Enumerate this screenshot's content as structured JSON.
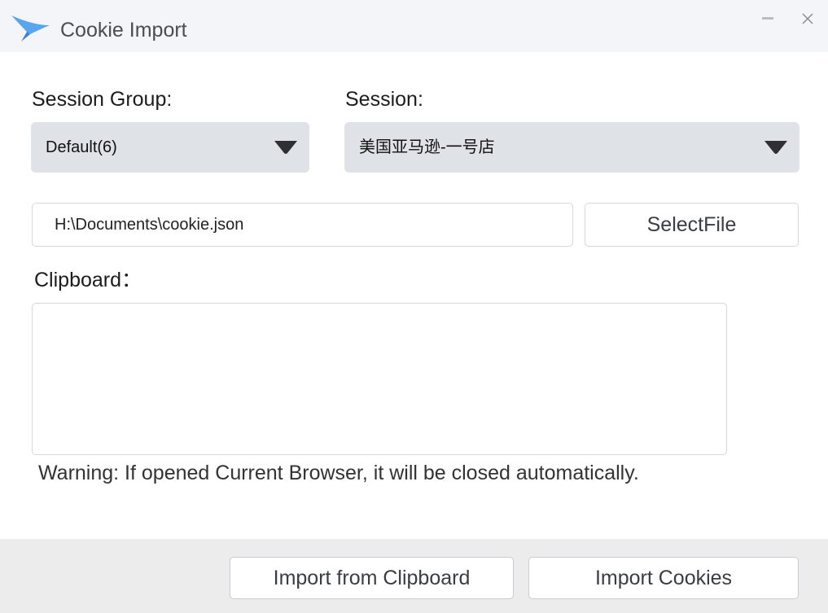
{
  "window": {
    "title": "Cookie Import",
    "logo_icon": "bird-logo-icon",
    "minimize_icon": "minimize-icon",
    "close_icon": "close-icon"
  },
  "form": {
    "session_group_label": "Session Group:",
    "session_group_value": "Default(6)",
    "session_label": "Session:",
    "session_value": "美国亚马逊-一号店",
    "file_path_value": "H:\\Documents\\cookie.json",
    "select_file_label": "SelectFile",
    "clipboard_label": "Clipboard：",
    "clipboard_value": "",
    "warning_text": "Warning: If opened Current Browser, it will be closed automatically."
  },
  "footer": {
    "import_clipboard_label": "Import from Clipboard",
    "import_cookies_label": "Import Cookies"
  },
  "colors": {
    "accent": "#4a90e2",
    "select_bg": "#dfe2e7",
    "titlebar_bg": "#f4f5f8",
    "footer_bg": "#ececec"
  }
}
